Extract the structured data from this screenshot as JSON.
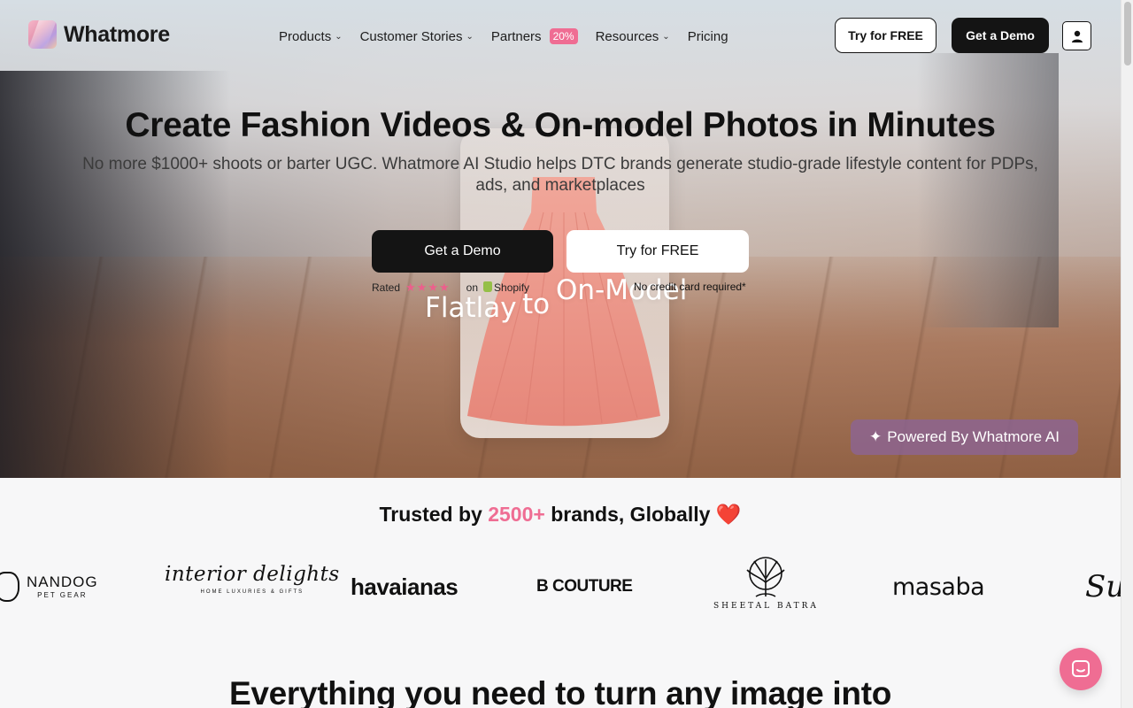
{
  "brand": {
    "name": "Whatmore",
    "accent_color": "#ef6d93"
  },
  "nav": {
    "items": [
      {
        "label": "Products",
        "has_dropdown": true
      },
      {
        "label": "Customer Stories",
        "has_dropdown": true
      },
      {
        "label": "Partners",
        "has_dropdown": false,
        "badge": "20%"
      },
      {
        "label": "Resources",
        "has_dropdown": true
      },
      {
        "label": "Pricing",
        "has_dropdown": false
      }
    ],
    "try_label": "Try for FREE",
    "demo_label": "Get a Demo",
    "user_icon": "user-icon"
  },
  "hero": {
    "title": "Create Fashion Videos & On-model Photos in Minutes",
    "subtitle": "No more $1000+ shoots or barter UGC. Whatmore AI Studio helps DTC brands generate studio-grade lifestyle content for PDPs, ads, and marketplaces",
    "demo_label": "Get a Demo",
    "try_label": "Try for FREE",
    "rated_label": "Rated",
    "stars": "★★★★",
    "on_label": "on",
    "shopify_label": "Shopify",
    "no_card": "No credit card required*",
    "overlay_flatlay": "Flatlay",
    "overlay_to": "to",
    "overlay_onmodel": "On-Model",
    "powered": "Powered By Whatmore AI"
  },
  "trusted": {
    "prefix": "Trusted by",
    "count": "2500+",
    "suffix": "brands, Globally",
    "heart": "❤️"
  },
  "brands": {
    "nandog": {
      "name": "NANDOG",
      "sub": "PET GEAR"
    },
    "interior": {
      "name": "interior delights",
      "tag": "HOME LUXURIES & GIFTS"
    },
    "havaianas": "havaianas",
    "bcouture": "B COUTURE",
    "sheetal": "SHEETAL BATRA",
    "masaba": "masaba",
    "partial": "Su"
  },
  "section_heading": "Everything you need to turn any image into"
}
